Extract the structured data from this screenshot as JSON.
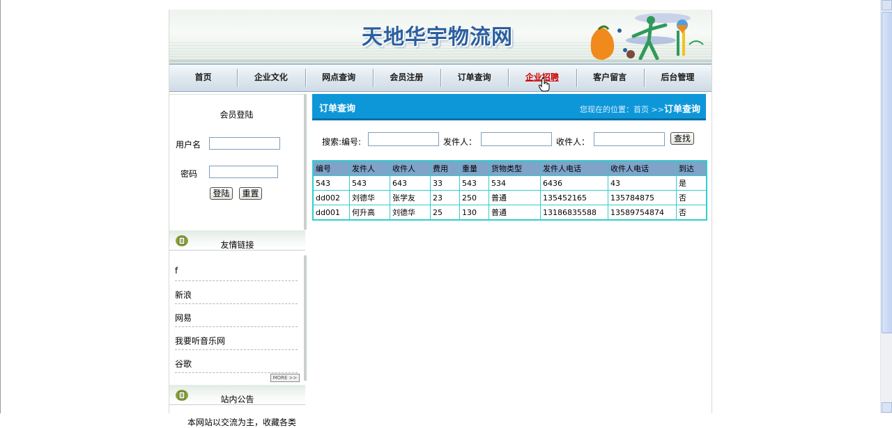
{
  "site": {
    "title": "天地华宇物流网"
  },
  "nav": {
    "items": [
      {
        "label": "首页"
      },
      {
        "label": "企业文化"
      },
      {
        "label": "网点查询"
      },
      {
        "label": "会员注册"
      },
      {
        "label": "订单查询"
      },
      {
        "label": "企业招聘",
        "active": true
      },
      {
        "label": "客户留言"
      },
      {
        "label": "后台管理"
      }
    ]
  },
  "login": {
    "title": "会员登陆",
    "username_label": "用户名",
    "username_value": "",
    "password_label": "密码",
    "password_value": "",
    "login_button": "登陆",
    "reset_button": "重置"
  },
  "friend_links": {
    "title": "友情链接",
    "items": [
      "f",
      "新浪",
      "网易",
      "我要听音乐网",
      "谷歌"
    ],
    "more": "MORE >>"
  },
  "notice": {
    "title": "站内公告",
    "text": "本网站以交流为主，收藏各类"
  },
  "main": {
    "title": "订单查询",
    "location_prefix": "您现在的位置：首页 >>",
    "location_current": "订单查询"
  },
  "search": {
    "id_label": "搜索:编号:",
    "id_value": "",
    "sender_label": "发件人：",
    "sender_value": "",
    "receiver_label": "收件人：",
    "receiver_value": "",
    "button": "查找"
  },
  "orders": {
    "columns": [
      "编号",
      "发件人",
      "收件人",
      "费用",
      "重量",
      "货物类型",
      "发件人电话",
      "收件人电话",
      "到达"
    ],
    "rows": [
      [
        "543",
        "543",
        "643",
        "33",
        "543",
        "534",
        "6436",
        "43",
        "是"
      ],
      [
        "dd002",
        "刘德华",
        "张学友",
        "23",
        "250",
        "普通",
        "135452165",
        "135784875",
        "否"
      ],
      [
        "dd001",
        "何升高",
        "刘德华",
        "25",
        "130",
        "普通",
        "13186835588",
        "13589754874",
        "否"
      ]
    ]
  },
  "colors": {
    "nav_active": "#cc0000",
    "header_blue": "#0e97d8",
    "table_border": "#33cccc",
    "table_header": "#7fa3c9"
  }
}
